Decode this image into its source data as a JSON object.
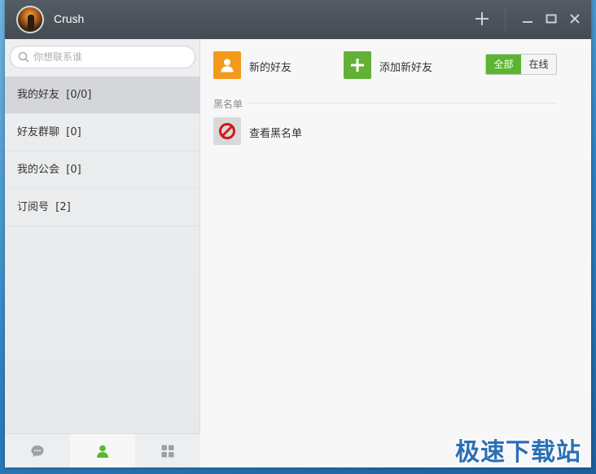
{
  "window": {
    "title": "Crush"
  },
  "titlebar": {
    "add_icon": "plus-icon",
    "minimize_icon": "minimize-icon",
    "maximize_icon": "maximize-icon",
    "close_icon": "close-icon"
  },
  "sidebar": {
    "search": {
      "placeholder": "你想联系谁"
    },
    "items": [
      {
        "label": "我的好友",
        "count": "[0/0]",
        "active": true
      },
      {
        "label": "好友群聊",
        "count": "[0]"
      },
      {
        "label": "我的公会",
        "count": "[0]"
      },
      {
        "label": "订阅号",
        "count": "[2]"
      }
    ],
    "bottom_tabs": [
      "chat-icon",
      "contacts-icon",
      "apps-icon"
    ],
    "active_tab": "contacts-icon"
  },
  "main": {
    "new_friend_label": "新的好友",
    "add_friend_label": "添加新好友",
    "filter": {
      "all": "全部",
      "online": "在线",
      "selected": "全部"
    },
    "blacklist_section": "黑名单",
    "view_blacklist_label": "查看黑名单"
  },
  "colors": {
    "accent_green": "#5cb531",
    "new_friend_orange": "#f39a1c",
    "add_friend_green": "#62b136",
    "ban_red": "#d0181b"
  },
  "watermark": "极速下载站"
}
